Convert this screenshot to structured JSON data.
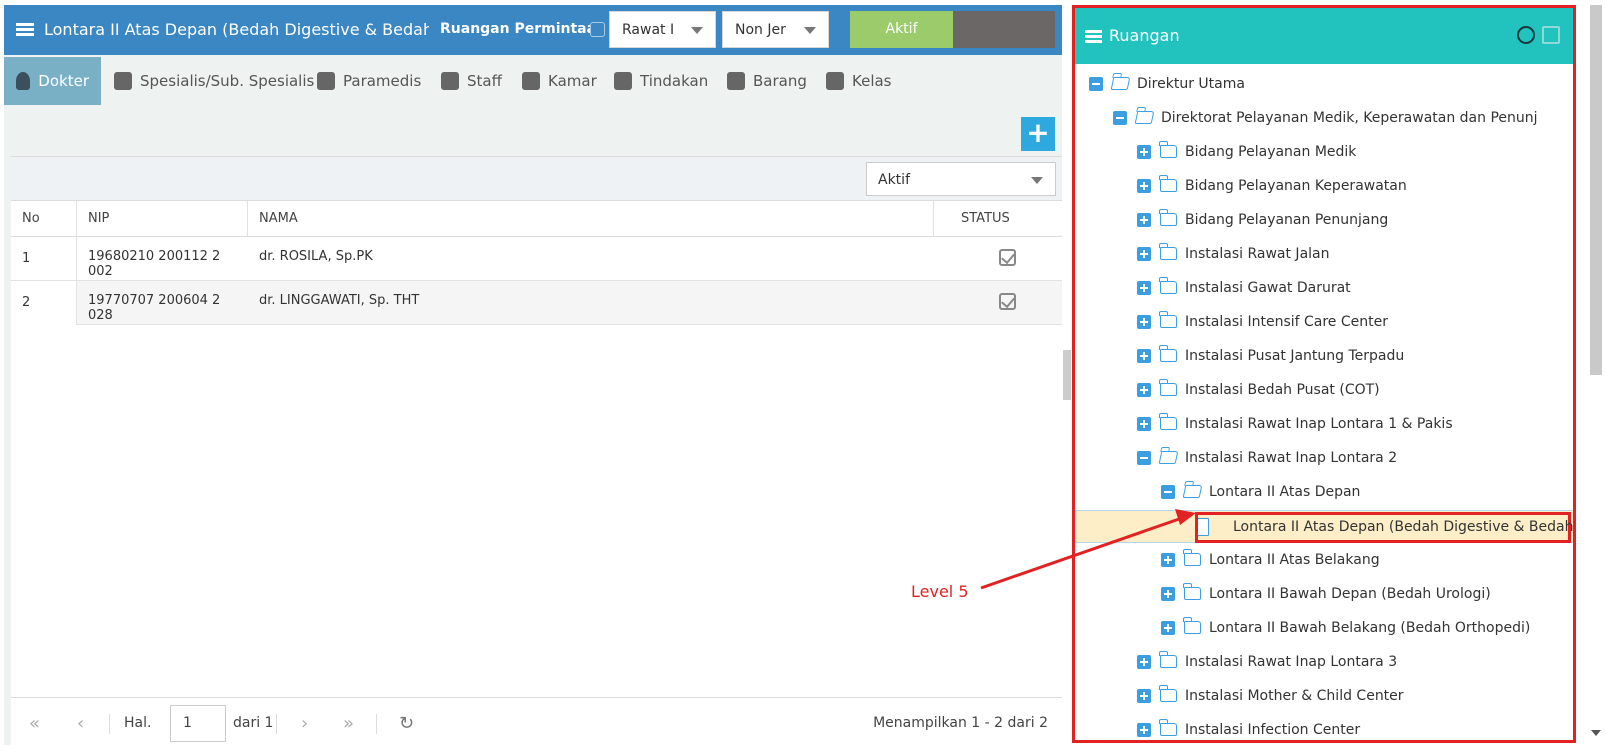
{
  "left": {
    "title": "Lontara II Atas Depan (Bedah Digestive & Bedah Pla",
    "ruangan_label": "Ruangan Permintaan",
    "select_rawat": "Rawat I",
    "select_jer": "Non Jer",
    "aktif_label": "Aktif",
    "tabs": [
      {
        "label": "Dokter",
        "icon": "doctor-icon"
      },
      {
        "label": "Spesialis/Sub. Spesialis",
        "icon": "user-md-icon"
      },
      {
        "label": "Paramedis",
        "icon": "stethoscope-icon"
      },
      {
        "label": "Staff",
        "icon": "user-icon"
      },
      {
        "label": "Kamar",
        "icon": "building-icon"
      },
      {
        "label": "Tindakan",
        "icon": "medkit-icon"
      },
      {
        "label": "Barang",
        "icon": "cubes-icon"
      },
      {
        "label": "Kelas",
        "icon": "star-icon"
      }
    ],
    "filter_value": "Aktif",
    "columns": [
      "No",
      "NIP",
      "NAMA",
      "STATUS"
    ],
    "rows": [
      {
        "no": "1",
        "nip": "19680210 200112 2 002",
        "nama": "dr. ROSILA, Sp.PK",
        "status": true
      },
      {
        "no": "2",
        "nip": "19770707 200604 2 028",
        "nama": "dr. LINGGAWATI, Sp. THT",
        "status": true
      }
    ],
    "pager": {
      "hal_label": "Hal.",
      "page": "1",
      "of_label": "dari 1",
      "summary": "Menampilkan 1 - 2 dari 2"
    }
  },
  "right": {
    "title": "Ruangan",
    "tree": [
      {
        "label": "Direktur Utama",
        "level": 0,
        "state": "open"
      },
      {
        "label": "Direktorat Pelayanan Medik, Keperawatan dan Penunj",
        "level": 1,
        "state": "open"
      },
      {
        "label": "Bidang Pelayanan Medik",
        "level": 2,
        "state": "closed"
      },
      {
        "label": "Bidang Pelayanan Keperawatan",
        "level": 2,
        "state": "closed"
      },
      {
        "label": "Bidang Pelayanan Penunjang",
        "level": 2,
        "state": "closed"
      },
      {
        "label": "Instalasi Rawat Jalan",
        "level": 2,
        "state": "closed"
      },
      {
        "label": "Instalasi Gawat Darurat",
        "level": 2,
        "state": "closed"
      },
      {
        "label": "Instalasi Intensif Care Center",
        "level": 2,
        "state": "closed"
      },
      {
        "label": "Instalasi Pusat Jantung Terpadu",
        "level": 2,
        "state": "closed"
      },
      {
        "label": "Instalasi Bedah Pusat (COT)",
        "level": 2,
        "state": "closed"
      },
      {
        "label": "Instalasi Rawat Inap Lontara 1 & Pakis",
        "level": 2,
        "state": "closed"
      },
      {
        "label": "Instalasi Rawat Inap Lontara 2",
        "level": 2,
        "state": "open"
      },
      {
        "label": "Lontara II Atas Depan",
        "level": 3,
        "state": "open"
      },
      {
        "label": "Lontara II Atas Depan (Bedah Digestive & Bedah Pla",
        "level": 4,
        "state": "leaf",
        "selected": true
      },
      {
        "label": "Lontara II Atas Belakang",
        "level": 3,
        "state": "closed"
      },
      {
        "label": "Lontara II Bawah Depan (Bedah Urologi)",
        "level": 3,
        "state": "closed"
      },
      {
        "label": "Lontara II Bawah Belakang (Bedah Orthopedi)",
        "level": 3,
        "state": "closed"
      },
      {
        "label": "Instalasi Rawat Inap Lontara 3",
        "level": 2,
        "state": "closed"
      },
      {
        "label": "Instalasi Mother & Child Center",
        "level": 2,
        "state": "closed"
      },
      {
        "label": "Instalasi Infection Center",
        "level": 2,
        "state": "closed"
      }
    ]
  },
  "annotation": {
    "text": "Level 5",
    "color": "#e22222"
  },
  "colors": {
    "header_blue": "#3a87c3",
    "teal": "#22c2bf",
    "aktif_green": "#9bcb6b",
    "tab_active": "#79b0c6",
    "accent_blue": "#2ea9e0",
    "highlight": "#e22222"
  }
}
